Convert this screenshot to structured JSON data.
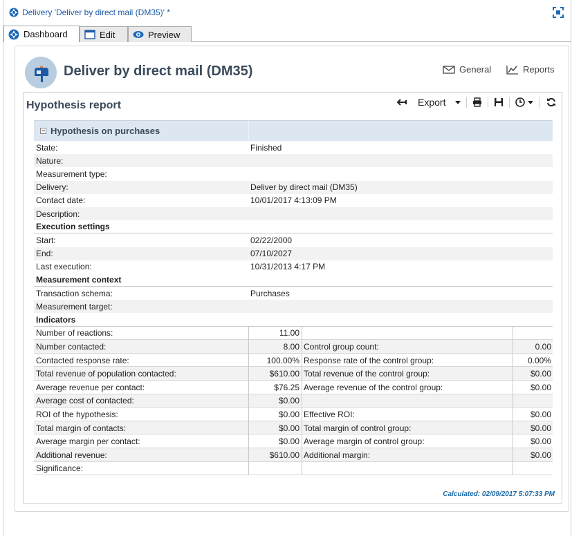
{
  "window": {
    "title": "Delivery 'Deliver by direct mail (DM35)' *"
  },
  "tabs": [
    {
      "label": "Dashboard",
      "icon": "dashboard-icon"
    },
    {
      "label": "Edit",
      "icon": "edit-window-icon"
    },
    {
      "label": "Preview",
      "icon": "eye-icon"
    }
  ],
  "header": {
    "title": "Deliver by direct mail (DM35)",
    "general_label": "General",
    "reports_label": "Reports"
  },
  "report": {
    "title": "Hypothesis report",
    "toolbar": {
      "export_label": "Export"
    },
    "group_title": "Hypothesis on purchases",
    "fields": [
      {
        "key": "State:",
        "value": "Finished"
      },
      {
        "key": "Nature:",
        "value": ""
      },
      {
        "key": "Measurement type:",
        "value": ""
      },
      {
        "key": "Delivery:",
        "value": "Deliver by direct mail (DM35)"
      },
      {
        "key": "Contact date:",
        "value": "10/01/2017 4:13:09 PM"
      },
      {
        "key": "Description:",
        "value": ""
      }
    ],
    "execution_title": "Execution settings",
    "execution": [
      {
        "key": "Start:",
        "value": "02/22/2000"
      },
      {
        "key": "End:",
        "value": "07/10/2027"
      },
      {
        "key": "Last execution:",
        "value": "10/31/2013 4:17 PM"
      }
    ],
    "measurement_title": "Measurement context",
    "measurement": [
      {
        "key": "Transaction schema:",
        "value": "Purchases"
      },
      {
        "key": "Measurement target:",
        "value": ""
      }
    ],
    "indicators_title": "Indicators",
    "indicators": [
      {
        "k1": "Number of reactions:",
        "v1": "11.00",
        "k2": "",
        "v2": ""
      },
      {
        "k1": "Number contacted:",
        "v1": "8.00",
        "k2": "Control group count:",
        "v2": "0.00"
      },
      {
        "k1": "Contacted response rate:",
        "v1": "100.00%",
        "k2": "Response rate of the control group:",
        "v2": "0.00%"
      },
      {
        "k1": "Total revenue of population contacted:",
        "v1": "$610.00",
        "k2": "Total revenue of the control group:",
        "v2": "$0.00"
      },
      {
        "k1": "Average revenue per contact:",
        "v1": "$76.25",
        "k2": "Average revenue of the control group:",
        "v2": "$0.00"
      },
      {
        "k1": "Average cost of contacted:",
        "v1": "$0.00",
        "k2": "",
        "v2": ""
      },
      {
        "k1": "ROI of the hypothesis:",
        "v1": "$0.00",
        "k2": "Effective ROI:",
        "v2": "$0.00"
      },
      {
        "k1": "Total margin of contacts:",
        "v1": "$0.00",
        "k2": "Total margin of control group:",
        "v2": "$0.00"
      },
      {
        "k1": "Average margin per contact:",
        "v1": "$0.00",
        "k2": "Average margin of control group:",
        "v2": "$0.00"
      },
      {
        "k1": "Additional revenue:",
        "v1": "$610.00",
        "k2": "Additional margin:",
        "v2": "$0.00"
      },
      {
        "k1": "Significance:",
        "v1": "",
        "k2": "",
        "v2": ""
      }
    ],
    "calculated": "Calculated: 02/09/2017 5:07:33 PM"
  }
}
